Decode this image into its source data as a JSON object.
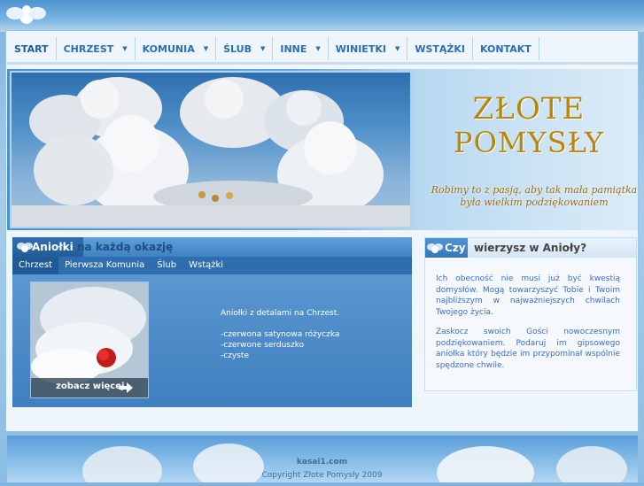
{
  "nav": {
    "items": [
      {
        "label": "START"
      },
      {
        "label": "CHRZEST"
      },
      {
        "label": "KOMUNIA"
      },
      {
        "label": "ŚLUB"
      },
      {
        "label": "INNE"
      },
      {
        "label": "WINIETKI"
      },
      {
        "label": "WSTĄŻKI"
      },
      {
        "label": "KONTAKT"
      }
    ]
  },
  "header": {
    "brand_line1": "ZŁOTE",
    "brand_line2": "POMYSŁY",
    "slogan_line1": "Robimy to z pasją, aby tak mała pamiątka",
    "slogan_line2": "była wielkim podziękowaniem"
  },
  "left_panel": {
    "title_strong": "Aniołki",
    "title_rest": "na każdą okazję",
    "tabs": [
      {
        "label": "Chrzest"
      },
      {
        "label": "Pierwsza Komunia"
      },
      {
        "label": "Ślub"
      },
      {
        "label": "Wstążki"
      }
    ],
    "more_label": "zobacz więcej",
    "description": [
      "Aniołki z detalami na Chrzest.",
      "",
      "-czerwona satynowa różyczka",
      "-czerwone serduszko",
      "-czyste"
    ]
  },
  "right_panel": {
    "title_strong": "Czy",
    "title_rest": "wierzysz w Anioły?",
    "para1": "Ich obecność nie musi już być kwestią domysłów. Mogą towarzyszyć Tobie i Twoim najbliższym w najważniejszych chwilach Twojego życia.",
    "para2": "Zaskocz swoich Gości nowoczesnym podziękowaniem. Podaruj im gipsowego aniołka który będzie im przypominał wspólnie spędzone chwile."
  },
  "footer": {
    "link": "kasai1.com",
    "copyright": "Copyright Złote Pomysły 2009"
  },
  "colors": {
    "nav_text": "#2b6fb3",
    "brand_gold": "#b8860b",
    "panel_blue": "#3d7fc0",
    "right_text": "#3a6cd0"
  }
}
